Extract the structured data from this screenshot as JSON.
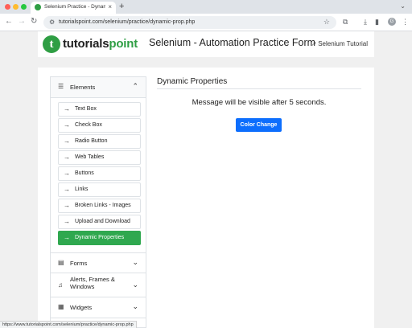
{
  "browser": {
    "tab_title": "Selenium Practice - Dynamic",
    "tab_close": "×",
    "new_tab": "+",
    "url": "tutorialspoint.com/selenium/practice/dynamic-prop.php",
    "profile_initial": "G",
    "status_url": "https://www.tutorialspoint.com/selenium/practice/dynamic-prop.php"
  },
  "icons": {
    "back": "arrow-left-icon",
    "forward": "arrow-right-icon",
    "reload": "reload-icon",
    "site_info": "site-info-icon",
    "bookmark": "star-icon",
    "extensions": "puzzle-icon",
    "download": "download-icon",
    "side_panel": "side-panel-icon",
    "menu": "kebab-menu-icon",
    "external": "external-link-icon"
  },
  "header": {
    "logo_mark": "t",
    "logo_text_main": "tutorials",
    "logo_text_accent": "point",
    "title": "Selenium - Automation Practice Form",
    "tutorial_link": "Selenium Tutorial"
  },
  "sidebar": {
    "elements_label": "Elements",
    "items": [
      {
        "label": "Text Box"
      },
      {
        "label": "Check Box"
      },
      {
        "label": "Radio Button"
      },
      {
        "label": "Web Tables"
      },
      {
        "label": "Buttons"
      },
      {
        "label": "Links"
      },
      {
        "label": "Broken Links - Images"
      },
      {
        "label": "Upload and Download"
      },
      {
        "label": "Dynamic Properties",
        "active": true
      }
    ],
    "sections": [
      {
        "label": "Forms"
      },
      {
        "label": "Alerts, Frames & Windows"
      },
      {
        "label": "Widgets"
      }
    ]
  },
  "content": {
    "title": "Dynamic Properties",
    "message": "Message will be visible after 5 seconds.",
    "button_label": "Color Change"
  },
  "colors": {
    "brand_green": "#2f9e44",
    "active_item": "#2fa84f",
    "primary_button": "#0d6efd"
  }
}
